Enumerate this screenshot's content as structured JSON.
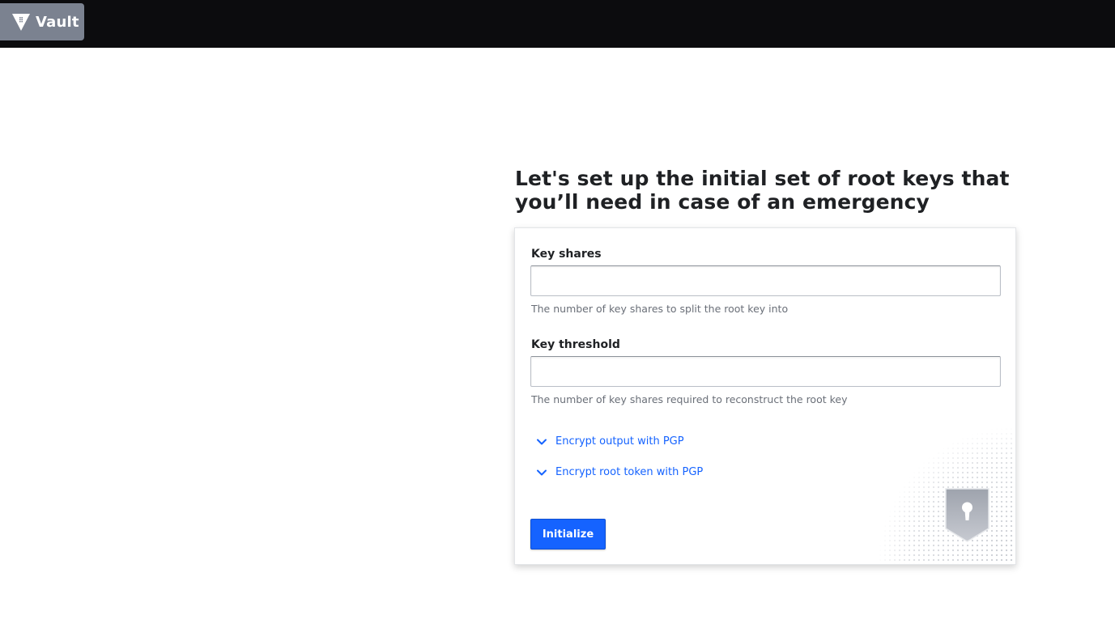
{
  "header": {
    "brand_label": "Vault",
    "logo_icon": "vault-triangle-icon"
  },
  "page": {
    "title": "Let's set up the initial set of root keys that you’ll need in case of an emergency"
  },
  "form": {
    "key_shares": {
      "label": "Key shares",
      "value": "",
      "help": "The number of key shares to split the root key into"
    },
    "key_threshold": {
      "label": "Key threshold",
      "value": "",
      "help": "The number of key shares required to reconstruct the root key"
    },
    "toggles": [
      {
        "label": "Encrypt output with PGP",
        "icon": "chevron-down-icon"
      },
      {
        "label": "Encrypt root token with PGP",
        "icon": "chevron-down-icon"
      }
    ],
    "submit_label": "Initialize"
  },
  "colors": {
    "topbar": "#0c0c0e",
    "brand_bg": "#7b8290",
    "accent": "#1563ff",
    "heading": "#1f2124",
    "help_text": "#6a6f78"
  },
  "decoration": {
    "icon": "keyhole-shield-icon"
  }
}
